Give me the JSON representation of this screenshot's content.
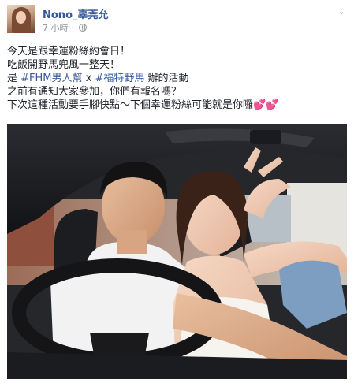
{
  "post": {
    "author_name": "Nono_辜莞允",
    "timestamp": "7 小時",
    "separator": " · ",
    "menu_icon": "chevron-down-icon",
    "privacy_icon": "globe-icon",
    "lines": [
      {
        "text": "今天是跟幸運粉絲約會日！"
      },
      {
        "text": "吃飯開野馬兜風一整天！"
      },
      {
        "prefix": "是 ",
        "tag1": "#FHM男人幫",
        "mid": " x ",
        "tag2": "#福特野馬",
        "suffix": " 辦的活動"
      },
      {
        "text": "之前有通知大家參加，你們有報名嗎？"
      },
      {
        "text": "下次這種活動要手腳快點～下個幸運粉絲可能就是你囉",
        "emoji": "💕💕"
      }
    ]
  },
  "colors": {
    "link": "#365899",
    "text": "#1d2129",
    "meta": "#90949c"
  }
}
